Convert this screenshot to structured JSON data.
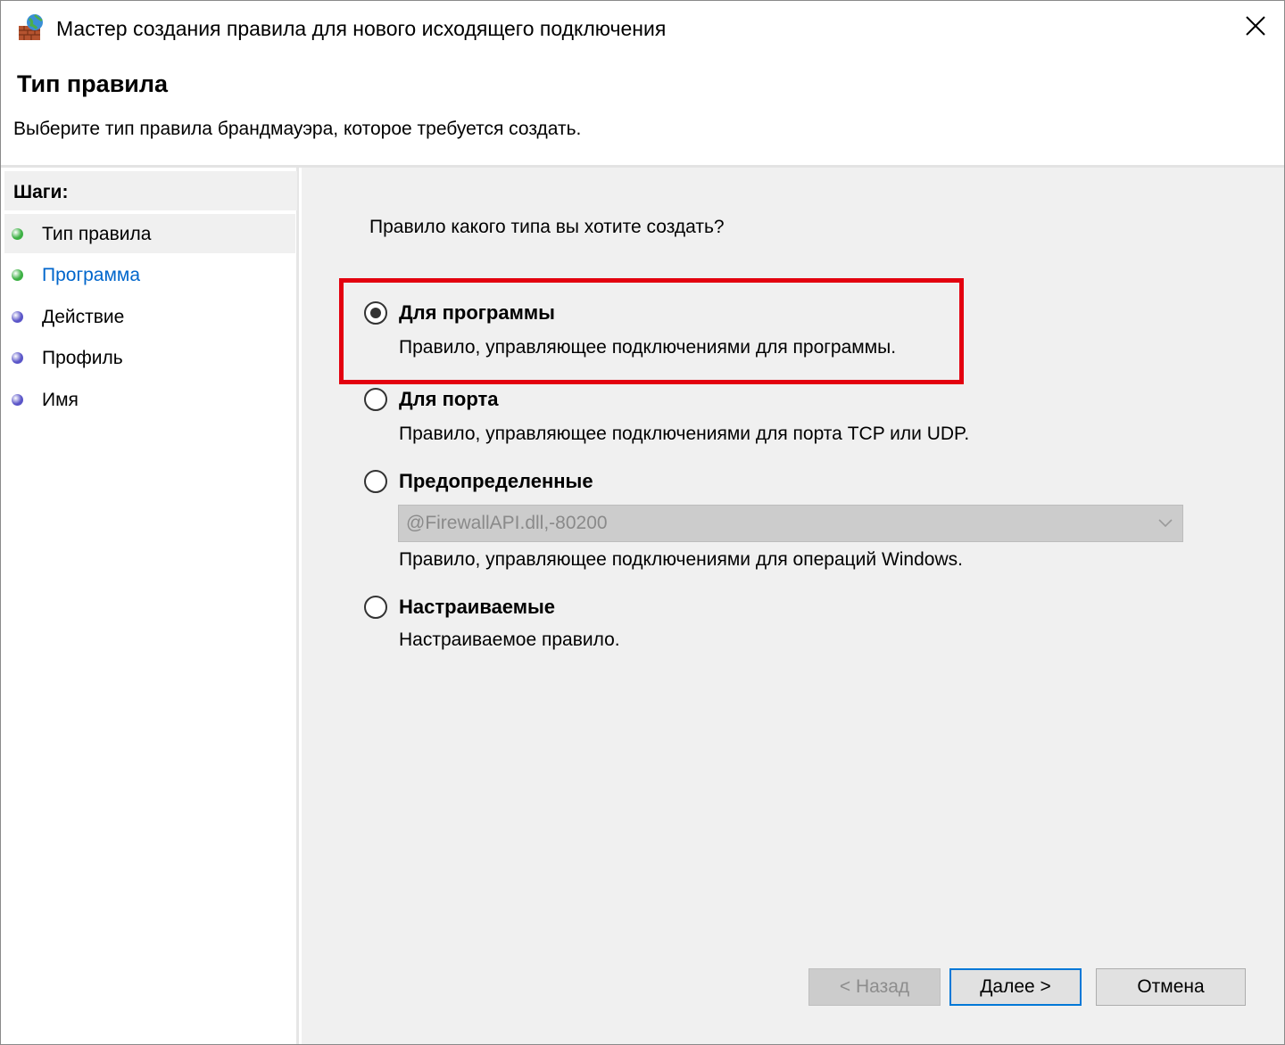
{
  "window": {
    "title": "Мастер создания правила для нового исходящего подключения",
    "icon": "firewall-icon",
    "close_icon": "close-icon"
  },
  "header": {
    "title": "Тип правила",
    "subtitle": "Выберите тип правила брандмауэра, которое требуется создать."
  },
  "steps": {
    "title": "Шаги:",
    "items": [
      {
        "label": "Тип правила",
        "dot_color": "#3cb043",
        "active": true,
        "link": false
      },
      {
        "label": "Программа",
        "dot_color": "#3cb043",
        "active": false,
        "link": true
      },
      {
        "label": "Действие",
        "dot_color": "#5a55c8",
        "active": false,
        "link": false
      },
      {
        "label": "Профиль",
        "dot_color": "#5a55c8",
        "active": false,
        "link": false
      },
      {
        "label": "Имя",
        "dot_color": "#5a55c8",
        "active": false,
        "link": false
      }
    ]
  },
  "main": {
    "question": "Правило какого типа вы хотите создать?",
    "options": [
      {
        "label": "Для программы",
        "description": "Правило, управляющее подключениями для программы.",
        "selected": true
      },
      {
        "label": "Для порта",
        "description": "Правило, управляющее подключениями для порта TCP или UDP.",
        "selected": false
      },
      {
        "label": "Предопределенные",
        "description": "Правило, управляющее подключениями для операций Windows.",
        "selected": false,
        "dropdown_value": "@FirewallAPI.dll,-80200",
        "dropdown_disabled": true
      },
      {
        "label": "Настраиваемые",
        "description": "Настраиваемое правило.",
        "selected": false
      }
    ],
    "highlight_color": "#e3000f"
  },
  "buttons": {
    "back": "< Назад",
    "next": "Далее >",
    "cancel": "Отмена"
  },
  "colors": {
    "accent": "#0078d7",
    "link": "#0066cc",
    "content_bg": "#f0f0f0"
  }
}
